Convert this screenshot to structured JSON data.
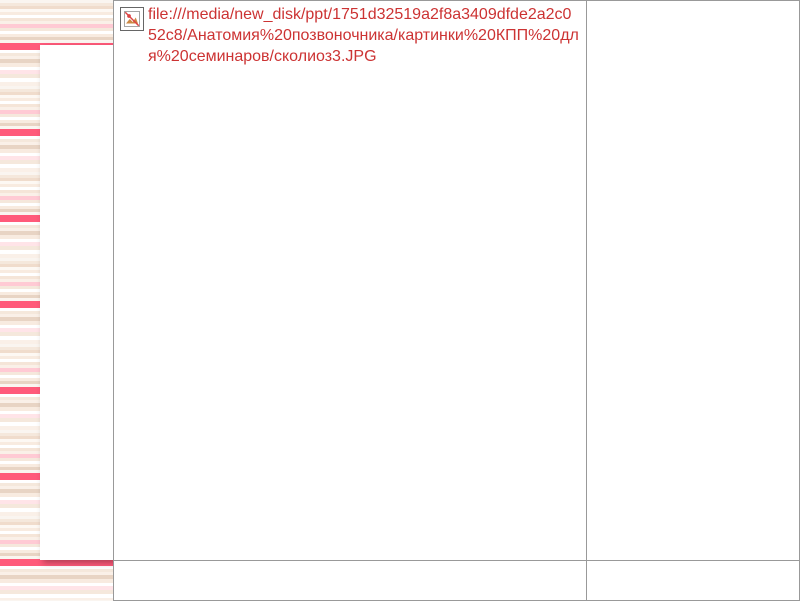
{
  "broken_image": {
    "path": "file:///media/new_disk/ppt/1751d32519a2f8a3409dfde2a2c052c8/Анатомия%20позвоночника/картинки%20КПП%20для%20семинаров/сколиоз3.JPG"
  }
}
